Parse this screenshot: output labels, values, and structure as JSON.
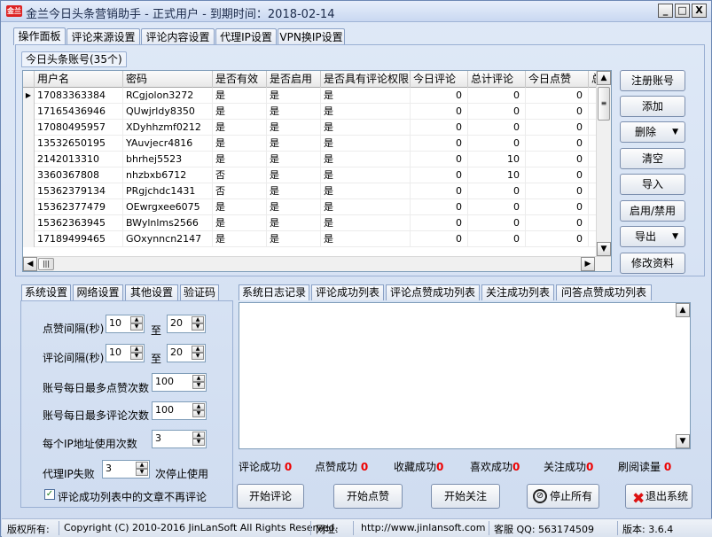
{
  "window": {
    "logo": "金兰",
    "title": "金兰今日头条营销助手 - 正式用户 - 到期时间：2018-02-14",
    "min_glyph": "_",
    "max_glyph": "□",
    "close_glyph": "X"
  },
  "main_tabs": [
    "操作面板",
    "评论来源设置",
    "评论内容设置",
    "代理IP设置",
    "VPN换IP设置"
  ],
  "accounts": {
    "group_title": "今日头条账号(35个)",
    "columns": [
      "用户名",
      "密码",
      "是否有效",
      "是否启用",
      "是否具有评论权限",
      "今日评论",
      "总计评论",
      "今日点赞",
      "总"
    ],
    "rows": [
      [
        "17083363384",
        "RCgjolon3272",
        "是",
        "是",
        "是",
        "0",
        "0",
        "0"
      ],
      [
        "17165436946",
        "QUwjrldy8350",
        "是",
        "是",
        "是",
        "0",
        "0",
        "0"
      ],
      [
        "17080495957",
        "XDyhhzmf0212",
        "是",
        "是",
        "是",
        "0",
        "0",
        "0"
      ],
      [
        "13532650195",
        "YAuvjecr4816",
        "是",
        "是",
        "是",
        "0",
        "0",
        "0"
      ],
      [
        "2142013310",
        "bhrhej5523",
        "是",
        "是",
        "是",
        "0",
        "10",
        "0"
      ],
      [
        "3360367808",
        "nhzbxb6712",
        "否",
        "是",
        "是",
        "0",
        "10",
        "0"
      ],
      [
        "15362379134",
        "PRgjchdc1431",
        "否",
        "是",
        "是",
        "0",
        "0",
        "0"
      ],
      [
        "15362377479",
        "OEwrgxee6075",
        "是",
        "是",
        "是",
        "0",
        "0",
        "0"
      ],
      [
        "15362363945",
        "BWylnlms2566",
        "是",
        "是",
        "是",
        "0",
        "0",
        "0"
      ],
      [
        "17189499465",
        "GOxynncn2147",
        "是",
        "是",
        "是",
        "0",
        "0",
        "0"
      ]
    ]
  },
  "side_buttons": {
    "register": "注册账号",
    "add": "添加",
    "delete": "删除",
    "clear": "清空",
    "import": "导入",
    "toggle": "启用/禁用",
    "export": "导出",
    "edit": "修改资料"
  },
  "settings_tabs": [
    "系统设置",
    "网络设置",
    "其他设置",
    "验证码"
  ],
  "settings": {
    "like_interval_label": "点赞间隔(秒)",
    "like_interval_from": "10",
    "like_interval_to": "20",
    "comment_interval_label": "评论间隔(秒)",
    "comment_interval_from": "10",
    "comment_interval_to": "20",
    "to_label": "至",
    "max_likes_label": "账号每日最多点赞次数",
    "max_likes": "100",
    "max_comments_label": "账号每日最多评论次数",
    "max_comments": "100",
    "ip_use_label": "每个IP地址使用次数",
    "ip_use": "3",
    "proxy_fail_label": "代理IP失败",
    "proxy_fail": "3",
    "proxy_fail_suffix": "次停止使用",
    "skip_commented_label": "评论成功列表中的文章不再评论",
    "skip_commented_checked": true
  },
  "log_tabs": [
    "系统日志记录",
    "评论成功列表",
    "评论点赞成功列表",
    "关注成功列表",
    "问答点赞成功列表"
  ],
  "stats": [
    {
      "label": "评论成功",
      "value": "0"
    },
    {
      "label": "点赞成功",
      "value": "0"
    },
    {
      "label": "收藏成功",
      "value": "0"
    },
    {
      "label": "喜欢成功",
      "value": "0"
    },
    {
      "label": "关注成功",
      "value": "0"
    },
    {
      "label": "刷阅读量",
      "value": "0"
    }
  ],
  "action_buttons": {
    "start_comment": "开始评论",
    "start_like": "开始点赞",
    "start_follow": "开始关注",
    "stop_all": "停止所有",
    "exit": "退出系统"
  },
  "status_bar": {
    "copyright_label": "版权所有:",
    "copyright": "Copyright (C) 2010-2016 JinLanSoft All Rights Reserved.",
    "site_label": "网址:",
    "site": "http://www.jinlansoft.com",
    "qq": "客服 QQ: 563174509",
    "version": "版本: 3.6.4"
  }
}
